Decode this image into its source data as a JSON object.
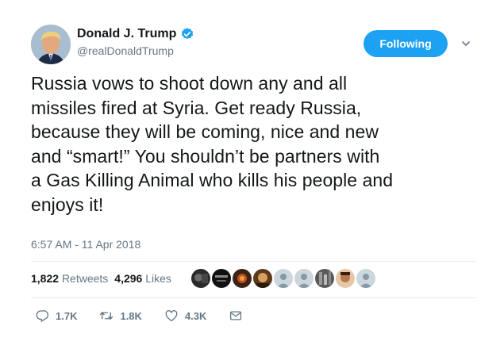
{
  "author": {
    "name": "Donald J. Trump",
    "handle": "@realDonaldTrump",
    "verified": true
  },
  "follow_button": {
    "label": "Following"
  },
  "tweet": {
    "lines": [
      "Russia vows to shoot down any and all",
      "missiles fired at Syria. Get ready Russia,",
      "because they will be coming, nice and new",
      "and “smart!” You shouldn’t be partners with",
      "a Gas Killing Animal who kills his people and",
      "enjoys it!"
    ],
    "timestamp": "6:57 AM - 11 Apr 2018"
  },
  "stats": {
    "retweets_count": "1,822",
    "retweets_label": "Retweets",
    "likes_count": "4,296",
    "likes_label": "Likes"
  },
  "actions": {
    "reply_count": "1.7K",
    "retweet_count": "1.8K",
    "like_count": "4.3K"
  },
  "icons": {
    "verified": "verified-badge-icon",
    "caret": "chevron-down-icon",
    "reply": "reply-icon",
    "retweet": "retweet-icon",
    "like": "heart-icon",
    "dm": "envelope-icon"
  },
  "colors": {
    "accent": "#1da1f2",
    "text": "#14171a",
    "secondary": "#657786",
    "divider": "#e6ecf0"
  }
}
